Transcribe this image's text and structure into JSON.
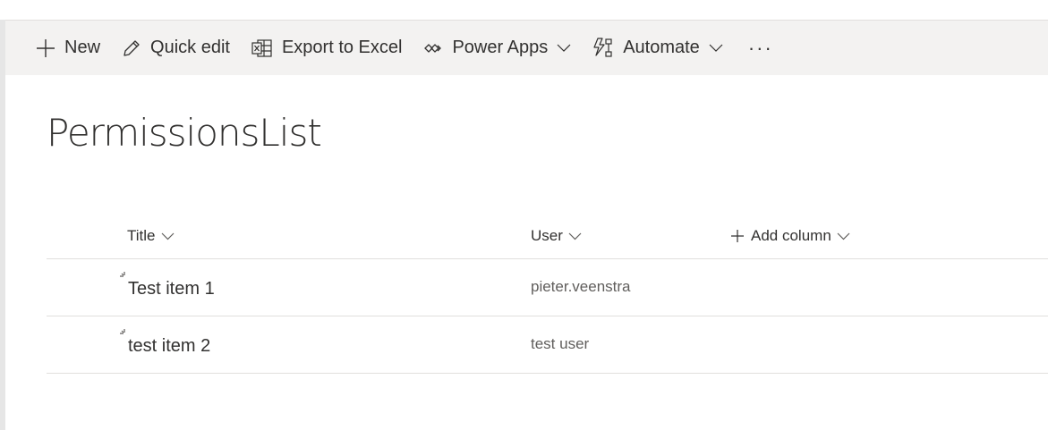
{
  "commandbar": {
    "new_label": "New",
    "quick_edit_label": "Quick edit",
    "export_label": "Export to Excel",
    "power_apps_label": "Power Apps",
    "automate_label": "Automate",
    "more_label": "···"
  },
  "list": {
    "title": "PermissionsList",
    "columns": {
      "title": "Title",
      "user": "User",
      "add_column": "Add column"
    },
    "rows": [
      {
        "title": "Test item 1",
        "user": "pieter.veenstra"
      },
      {
        "title": "test item 2",
        "user": "test user"
      }
    ]
  },
  "icons": {
    "new": "plus-icon",
    "quick_edit": "pencil-icon",
    "export": "excel-icon",
    "power_apps": "power-apps-icon",
    "automate": "automate-icon",
    "chevron": "chevron-down-icon",
    "new_item_marker": "new-item-marker-icon"
  }
}
